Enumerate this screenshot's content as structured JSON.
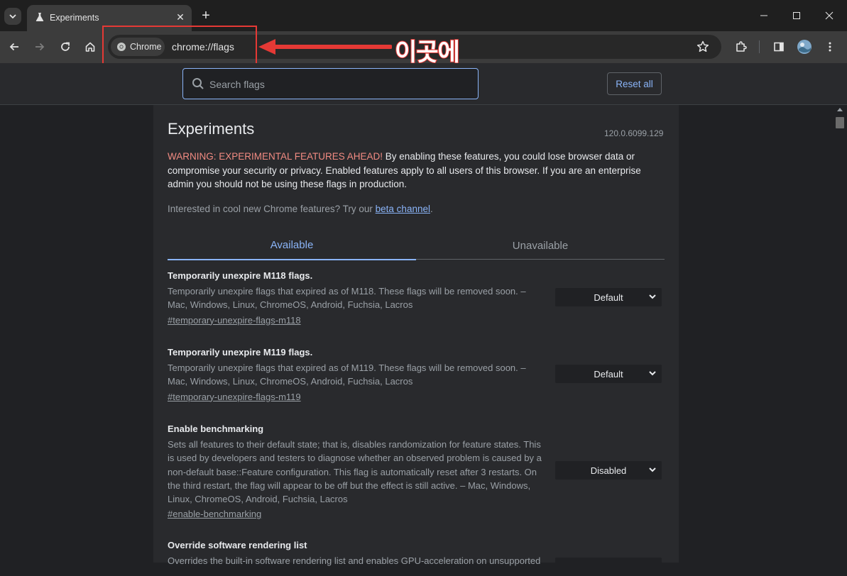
{
  "window": {
    "tab_title": "Experiments",
    "new_tab_symbol": "+",
    "close_symbol": "✕"
  },
  "toolbar": {
    "chip_label": "Chrome",
    "url": "chrome://flags"
  },
  "annotation": {
    "text": "이곳에",
    "color": "#e53935"
  },
  "header": {
    "search_placeholder": "Search flags",
    "reset_label": "Reset all"
  },
  "page": {
    "title": "Experiments",
    "version": "120.0.6099.129",
    "warning_prefix": "WARNING: EXPERIMENTAL FEATURES AHEAD!",
    "warning_body": " By enabling these features, you could lose browser data or compromise your security or privacy. Enabled features apply to all users of this browser. If you are an enterprise admin you should not be using these flags in production.",
    "interest_prefix": "Interested in cool new Chrome features? Try our ",
    "interest_link": "beta channel",
    "interest_suffix": ".",
    "tabs": [
      {
        "label": "Available",
        "active": true
      },
      {
        "label": "Unavailable",
        "active": false
      }
    ]
  },
  "flags": [
    {
      "name": "Temporarily unexpire M118 flags.",
      "description": "Temporarily unexpire flags that expired as of M118. These flags will be removed soon. – Mac, Windows, Linux, ChromeOS, Android, Fuchsia, Lacros",
      "link": "#temporary-unexpire-flags-m118",
      "value": "Default"
    },
    {
      "name": "Temporarily unexpire M119 flags.",
      "description": "Temporarily unexpire flags that expired as of M119. These flags will be removed soon. – Mac, Windows, Linux, ChromeOS, Android, Fuchsia, Lacros",
      "link": "#temporary-unexpire-flags-m119",
      "value": "Default"
    },
    {
      "name": "Enable benchmarking",
      "description": "Sets all features to their default state; that is, disables randomization for feature states. This is used by developers and testers to diagnose whether an observed problem is caused by a non-default base::Feature configuration. This flag is automatically reset after 3 restarts. On the third restart, the flag will appear to be off but the effect is still active. – Mac, Windows, Linux, ChromeOS, Android, Fuchsia, Lacros",
      "link": "#enable-benchmarking",
      "value": "Disabled"
    },
    {
      "name": "Override software rendering list",
      "description": "Overrides the built-in software rendering list and enables GPU-acceleration on unsupported",
      "link": "",
      "value": ""
    }
  ],
  "colors": {
    "accent": "#8ab4f8",
    "warning": "#f28b82",
    "background": "#202124",
    "surface": "#292a2d"
  }
}
